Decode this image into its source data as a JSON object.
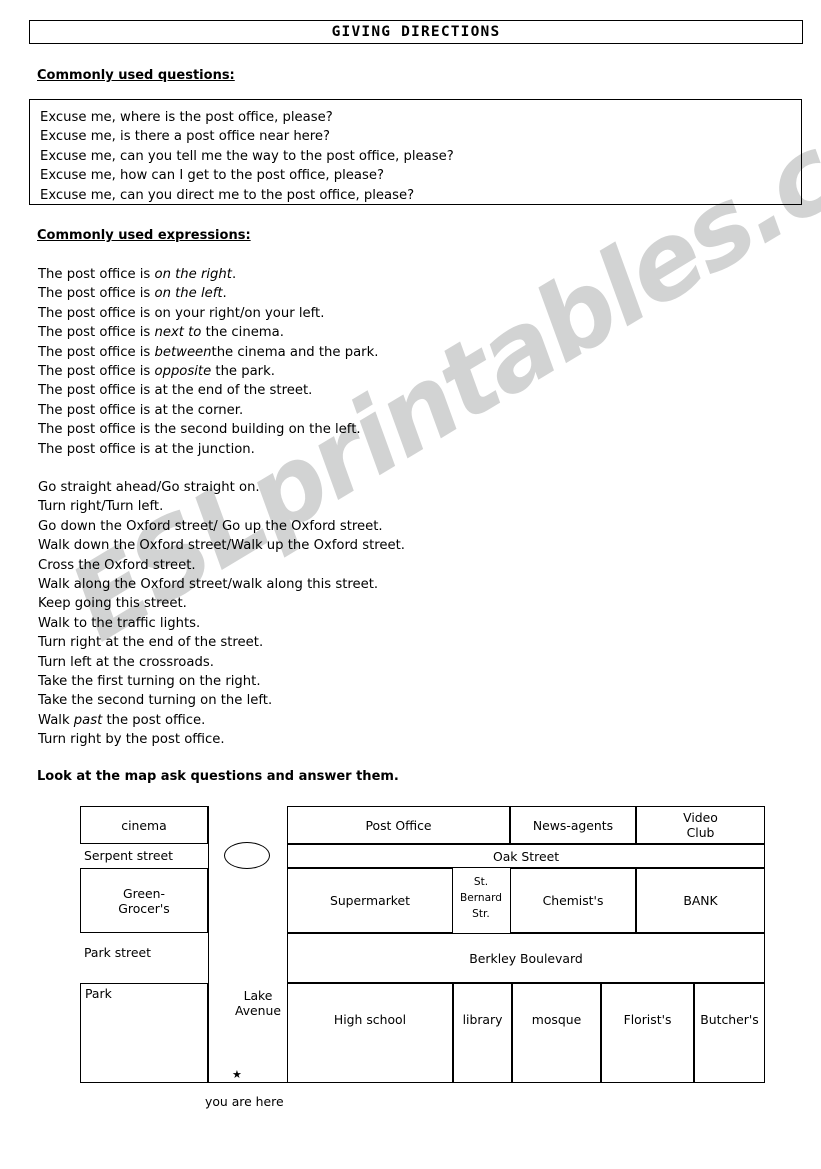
{
  "title": "GIVING DIRECTIONS",
  "sections": {
    "questions_heading": "Commonly used questions:",
    "expressions_heading": "Commonly used expressions:",
    "map_instruction": "Look at the map ask questions and answer them."
  },
  "questions": [
    "Excuse me, where is the post office, please?",
    "Excuse me, is there a post office near here?",
    "Excuse me, can you tell me the way to the post office, please?",
    "Excuse me, how can I get to the post office, please?",
    "Excuse me, can you direct me to the post office, please?"
  ],
  "expressions_location": [
    {
      "pre": "The post office is ",
      "em": "on the right",
      "post": "."
    },
    {
      "pre": "The post office is ",
      "em": "on the left",
      "post": "."
    },
    {
      "pre": "The post office is on your right/on your left.",
      "em": "",
      "post": ""
    },
    {
      "pre": "The post office is ",
      "em": "next to",
      "post": " the cinema."
    },
    {
      "pre": "The post office is ",
      "em": "between",
      "post": "the cinema and the park."
    },
    {
      "pre": "The post office is ",
      "em": "opposite",
      "post": " the park."
    },
    {
      "pre": "The post office is at the end of the street.",
      "em": "",
      "post": ""
    },
    {
      "pre": "The post office is at the corner.",
      "em": "",
      "post": ""
    },
    {
      "pre": "The post office is the second building on the left.",
      "em": "",
      "post": ""
    },
    {
      "pre": "The post office is at the junction.",
      "em": "",
      "post": ""
    }
  ],
  "expressions_movement": [
    {
      "pre": "Go straight ahead/Go straight on.",
      "em": "",
      "post": ""
    },
    {
      "pre": "Turn right/Turn left.",
      "em": "",
      "post": ""
    },
    {
      "pre": "Go down the Oxford street/ Go up the Oxford street.",
      "em": "",
      "post": ""
    },
    {
      "pre": "Walk down the Oxford street/Walk up the Oxford street.",
      "em": "",
      "post": ""
    },
    {
      "pre": "Cross the Oxford street.",
      "em": "",
      "post": ""
    },
    {
      "pre": "Walk along the Oxford street/walk along this street.",
      "em": "",
      "post": ""
    },
    {
      "pre": "Keep going this street.",
      "em": "",
      "post": ""
    },
    {
      "pre": "Walk to the traffic lights.",
      "em": "",
      "post": ""
    },
    {
      "pre": "Turn right at the end of the street.",
      "em": "",
      "post": ""
    },
    {
      "pre": "Turn left at the crossroads.",
      "em": "",
      "post": ""
    },
    {
      "pre": "Take the first turning on the right.",
      "em": "",
      "post": ""
    },
    {
      "pre": "Take the second turning on the left.",
      "em": "",
      "post": ""
    },
    {
      "pre": "Walk ",
      "em": "past",
      "post": " the post office."
    },
    {
      "pre": "Turn right by the post office.",
      "em": "",
      "post": ""
    }
  ],
  "map": {
    "buildings": {
      "cinema": "cinema",
      "green_grocers": "Green-\nGrocer's",
      "park": "Park",
      "post_office": "Post Office",
      "news_agents": "News-agents",
      "video_club": "Video\nClub",
      "supermarket": "Supermarket",
      "chemists": "Chemist's",
      "bank": "BANK",
      "high_school": "High school",
      "library": "library",
      "mosque": "mosque",
      "florists": "Florist's",
      "butchers": "Butcher's"
    },
    "streets": {
      "serpent_street": "Serpent street",
      "oak_street": "Oak Street",
      "park_street": "Park street",
      "lake_avenue": "Lake\nAvenue",
      "berkley_boulevard": "Berkley Boulevard",
      "st_bernard_str": "St.\nBernard\nStr."
    },
    "marker": {
      "symbol": "★",
      "label": "you are here"
    }
  },
  "watermark": {
    "text": "ESLprintables.com",
    "color": "#d2d3d3"
  }
}
